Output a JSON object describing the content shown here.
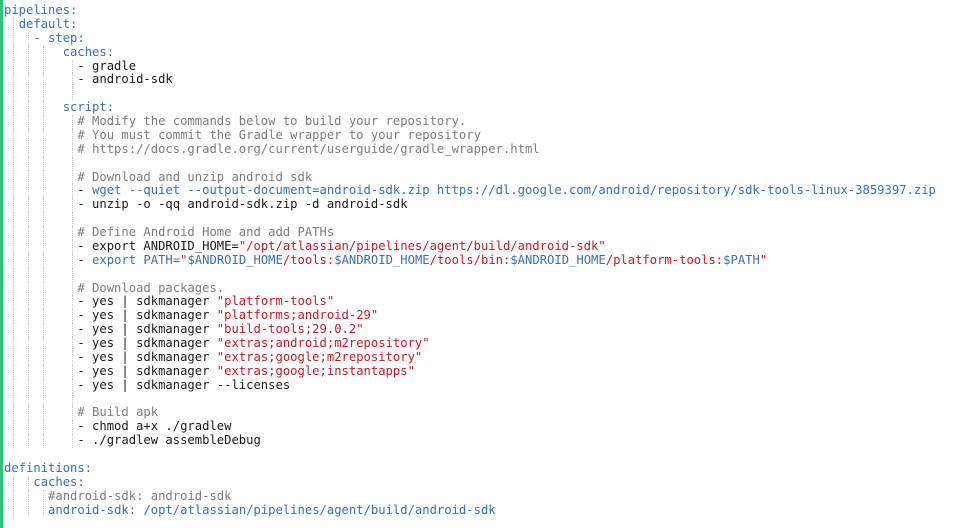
{
  "editor": {
    "file_type": "yaml",
    "cursor": {
      "line": 37,
      "after_text": true
    },
    "lines": [
      [
        {
          "t": "k",
          "v": "pipelines:"
        }
      ],
      [
        {
          "t": "p",
          "v": "  "
        },
        {
          "t": "k",
          "v": "default:"
        }
      ],
      [
        {
          "t": "p",
          "v": "    "
        },
        {
          "t": "k",
          "v": "- step:"
        }
      ],
      [
        {
          "t": "p",
          "v": "        "
        },
        {
          "t": "k",
          "v": "caches:"
        }
      ],
      [
        {
          "t": "p",
          "v": "          - gradle"
        }
      ],
      [
        {
          "t": "p",
          "v": "          - android-sdk"
        }
      ],
      [
        {
          "t": "p",
          "v": ""
        }
      ],
      [
        {
          "t": "p",
          "v": "        "
        },
        {
          "t": "k",
          "v": "script:"
        }
      ],
      [
        {
          "t": "p",
          "v": "          "
        },
        {
          "t": "c",
          "v": "# Modify the commands below to build your repository."
        }
      ],
      [
        {
          "t": "p",
          "v": "          "
        },
        {
          "t": "c",
          "v": "# You must commit the Gradle wrapper to your repository"
        }
      ],
      [
        {
          "t": "p",
          "v": "          "
        },
        {
          "t": "c",
          "v": "# https://docs.gradle.org/current/userguide/gradle_wrapper.html"
        }
      ],
      [
        {
          "t": "p",
          "v": ""
        }
      ],
      [
        {
          "t": "p",
          "v": "          "
        },
        {
          "t": "c",
          "v": "# Download and unzip android sdk"
        }
      ],
      [
        {
          "t": "p",
          "v": "          - "
        },
        {
          "t": "k",
          "v": "wget --quiet --output-document=android-sdk.zip https://dl.google.com/android/repository/sdk-tools-linux-3859397.zip"
        }
      ],
      [
        {
          "t": "p",
          "v": "          - unzip -o -qq android-sdk.zip -d android-sdk"
        }
      ],
      [
        {
          "t": "p",
          "v": ""
        }
      ],
      [
        {
          "t": "p",
          "v": "          "
        },
        {
          "t": "c",
          "v": "# Define Android Home and add PATHs"
        }
      ],
      [
        {
          "t": "p",
          "v": "          - export ANDROID_HOME="
        },
        {
          "t": "s",
          "v": "\"/opt/atlassian/pipelines/agent/build/android-sdk\""
        }
      ],
      [
        {
          "t": "p",
          "v": "          - "
        },
        {
          "t": "k",
          "v": "export PATH="
        },
        {
          "t": "s",
          "v": "\""
        },
        {
          "t": "v",
          "v": "$ANDROID_HOME"
        },
        {
          "t": "s",
          "v": "/tools:"
        },
        {
          "t": "v",
          "v": "$ANDROID_HOME"
        },
        {
          "t": "s",
          "v": "/tools/bin:"
        },
        {
          "t": "v",
          "v": "$ANDROID_HOME"
        },
        {
          "t": "s",
          "v": "/platform-tools:"
        },
        {
          "t": "v",
          "v": "$PATH"
        },
        {
          "t": "s",
          "v": "\""
        }
      ],
      [
        {
          "t": "p",
          "v": ""
        }
      ],
      [
        {
          "t": "p",
          "v": "          "
        },
        {
          "t": "c",
          "v": "# Download packages."
        }
      ],
      [
        {
          "t": "p",
          "v": "          - yes | sdkmanager "
        },
        {
          "t": "s",
          "v": "\"platform-tools\""
        }
      ],
      [
        {
          "t": "p",
          "v": "          - yes | sdkmanager "
        },
        {
          "t": "s",
          "v": "\"platforms;android-29\""
        }
      ],
      [
        {
          "t": "p",
          "v": "          - yes | sdkmanager "
        },
        {
          "t": "s",
          "v": "\"build-tools;29.0.2\""
        }
      ],
      [
        {
          "t": "p",
          "v": "          - yes | sdkmanager "
        },
        {
          "t": "s",
          "v": "\"extras;android;m2repository\""
        }
      ],
      [
        {
          "t": "p",
          "v": "          - yes | sdkmanager "
        },
        {
          "t": "s",
          "v": "\"extras;google;m2repository\""
        }
      ],
      [
        {
          "t": "p",
          "v": "          - yes | sdkmanager "
        },
        {
          "t": "s",
          "v": "\"extras;google;instantapps\""
        }
      ],
      [
        {
          "t": "p",
          "v": "          - yes | sdkmanager --licenses"
        }
      ],
      [
        {
          "t": "p",
          "v": ""
        }
      ],
      [
        {
          "t": "p",
          "v": "          "
        },
        {
          "t": "c",
          "v": "# Build apk"
        }
      ],
      [
        {
          "t": "p",
          "v": "          - chmod a+x ./gradlew"
        }
      ],
      [
        {
          "t": "p",
          "v": "          - ./gradlew assembleDebug"
        }
      ],
      [
        {
          "t": "p",
          "v": ""
        }
      ],
      [
        {
          "t": "k",
          "v": "definitions:"
        }
      ],
      [
        {
          "t": "p",
          "v": "    "
        },
        {
          "t": "k",
          "v": "caches:"
        }
      ],
      [
        {
          "t": "p",
          "v": "      "
        },
        {
          "t": "c",
          "v": "#android-sdk: android-sdk"
        }
      ],
      [
        {
          "t": "p",
          "v": "      "
        },
        {
          "t": "k",
          "v": "android-sdk:"
        },
        {
          "t": "p",
          "v": " "
        },
        {
          "t": "k",
          "v": "/opt/atlassian/pipelines/agent/build/android-sdk"
        }
      ]
    ]
  }
}
